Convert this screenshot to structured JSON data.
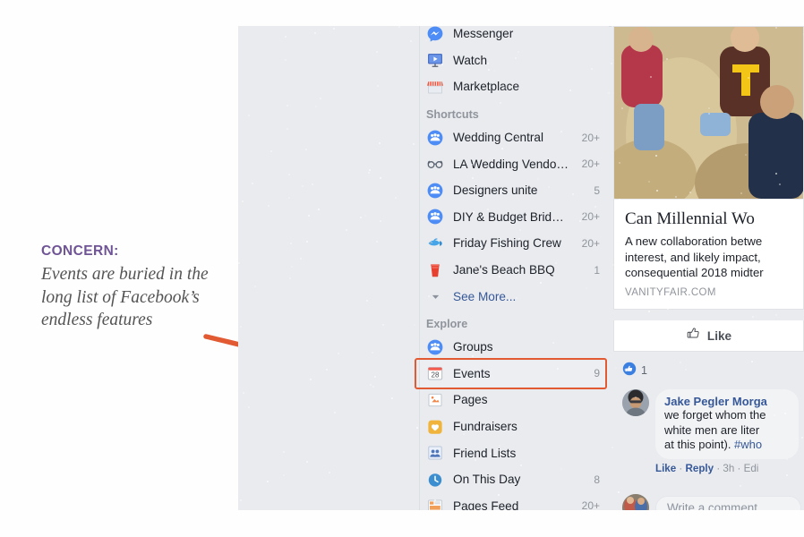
{
  "annotation": {
    "label": "CONCERN:",
    "body": "Events are buried in the long list of Facebook’s endless features",
    "label_color": "#6f5496",
    "body_color": "#545454",
    "arrow_color": "#e15a32"
  },
  "highlight": {
    "target": "Events",
    "border_color": "#e15a32"
  },
  "sidebar": {
    "top_items": [
      {
        "label": "Messenger",
        "icon": "messenger-icon",
        "count": ""
      },
      {
        "label": "Watch",
        "icon": "watch-icon",
        "count": ""
      },
      {
        "label": "Marketplace",
        "icon": "marketplace-icon",
        "count": ""
      }
    ],
    "shortcuts_header": "Shortcuts",
    "shortcuts": [
      {
        "label": "Wedding Central",
        "icon": "group-icon",
        "count": "20+"
      },
      {
        "label": "LA Wedding Vendo…",
        "icon": "glasses-icon",
        "count": "20+"
      },
      {
        "label": "Designers unite",
        "icon": "group-icon",
        "count": "5"
      },
      {
        "label": "DIY & Budget Brid…",
        "icon": "group-icon",
        "count": "20+"
      },
      {
        "label": "Friday Fishing Crew",
        "icon": "fish-icon",
        "count": "20+"
      },
      {
        "label": "Jane's Beach BBQ",
        "icon": "cup-icon",
        "count": "1"
      }
    ],
    "see_more": "See More...",
    "explore_header": "Explore",
    "explore": [
      {
        "label": "Groups",
        "icon": "group-icon",
        "count": ""
      },
      {
        "label": "Events",
        "icon": "calendar-icon",
        "count": "9"
      },
      {
        "label": "Pages",
        "icon": "pages-icon",
        "count": ""
      },
      {
        "label": "Fundraisers",
        "icon": "fundraiser-icon",
        "count": ""
      },
      {
        "label": "Friend Lists",
        "icon": "friend-lists-icon",
        "count": ""
      },
      {
        "label": "On This Day",
        "icon": "clock-icon",
        "count": "8"
      },
      {
        "label": "Pages Feed",
        "icon": "pages-feed-icon",
        "count": "20+"
      }
    ]
  },
  "feed": {
    "link_title": "Can Millennial Wo",
    "link_desc_lines": [
      "A new collaboration betwe",
      "interest, and likely impact,",
      "consequential 2018 midter"
    ],
    "link_domain": "VANITYFAIR.COM",
    "like_label": "Like",
    "reaction_count": "1",
    "comment": {
      "author": "Jake Pegler Morga",
      "lines": [
        "we forget whom the",
        "white men are liter",
        "at this point). "
      ],
      "hashtag": "#who",
      "actions_like": "Like",
      "actions_reply": "Reply",
      "actions_time": "3h",
      "actions_edit": "Edi",
      "sep": " · "
    },
    "composer_placeholder": "Write a comment..."
  }
}
